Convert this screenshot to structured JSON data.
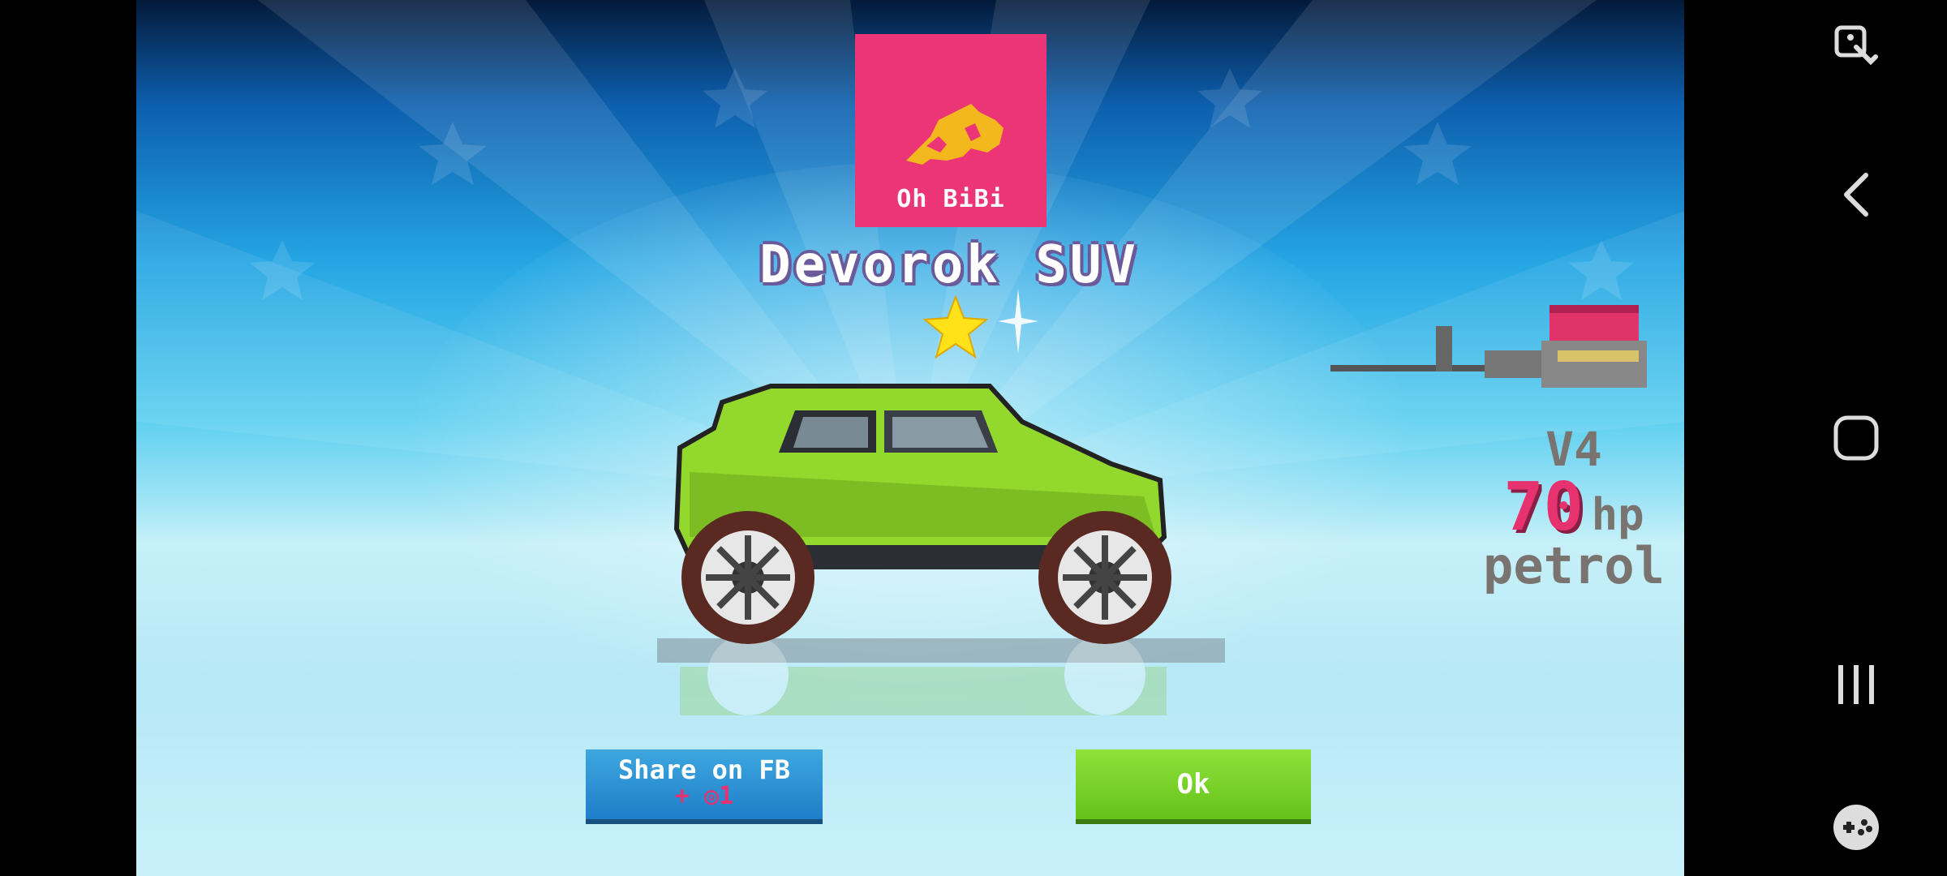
{
  "game": {
    "brand": {
      "name": "Oh BiBi",
      "color": "#ec3576"
    },
    "car_name": "Devorok SUV",
    "rating_stars": 1,
    "engine": {
      "type": "V4",
      "power": "70",
      "unit": "hp",
      "fuel": "petrol"
    },
    "buttons": {
      "share": {
        "label": "Share on FB",
        "reward": "+ ◎1"
      },
      "ok": {
        "label": "Ok"
      }
    }
  },
  "system_nav": {
    "icons": [
      "accessibility-icon",
      "back-icon",
      "home-icon",
      "recents-icon",
      "game-tools-icon"
    ]
  }
}
